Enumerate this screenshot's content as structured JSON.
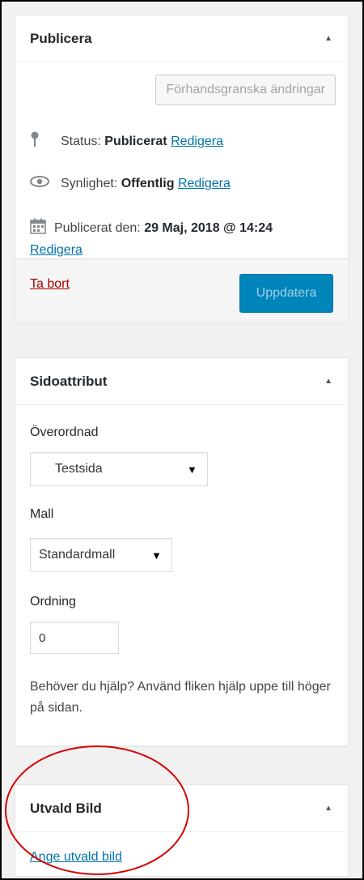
{
  "publish": {
    "title": "Publicera",
    "preview_button": "Förhandsgranska ändringar",
    "status_label": "Status:",
    "status_value": "Publicerat",
    "status_edit": "Redigera",
    "visibility_label": "Synlighet:",
    "visibility_value": "Offentlig",
    "visibility_edit": "Redigera",
    "published_label": "Publicerat den:",
    "published_value": "29 Maj, 2018 @ 14:24",
    "published_edit": "Redigera",
    "delete_link": "Ta bort",
    "update_button": "Uppdatera"
  },
  "attributes": {
    "title": "Sidoattribut",
    "parent_label": "Överordnad",
    "parent_value": "Testsida",
    "template_label": "Mall",
    "template_value": "Standardmall",
    "order_label": "Ordning",
    "order_value": "0",
    "help_text": "Behöver du hjälp? Använd fliken hjälp uppe till höger på sidan."
  },
  "featured": {
    "title": "Utvald Bild",
    "set_link": "Ange utvald bild"
  },
  "icons": {
    "toggle": "triangle-up-icon",
    "status": "pin-icon",
    "visibility": "eye-icon",
    "date": "calendar-icon"
  },
  "colors": {
    "primary": "#0085ba",
    "link": "#0073aa",
    "delete": "#a00000",
    "annotation": "#d40000"
  }
}
